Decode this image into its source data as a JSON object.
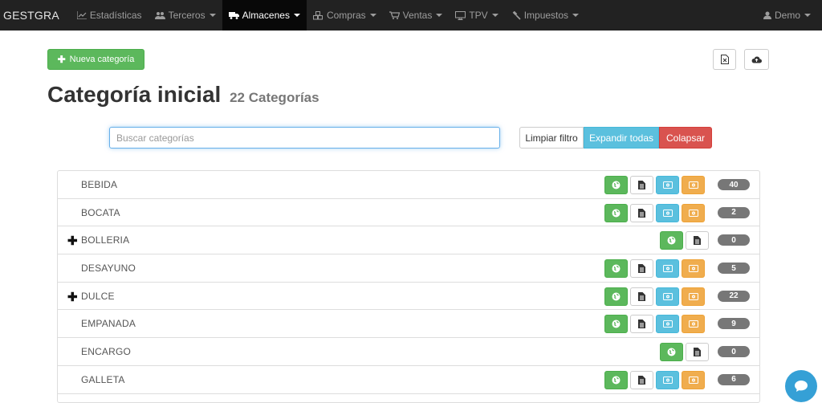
{
  "navbar": {
    "brand": "GESTGRA",
    "items": [
      {
        "label": "Estadísticas",
        "icon": "line-chart-icon",
        "dropdown": false,
        "active": false
      },
      {
        "label": "Terceros",
        "icon": "users-icon",
        "dropdown": true,
        "active": false
      },
      {
        "label": "Almacenes",
        "icon": "truck-icon",
        "dropdown": true,
        "active": true
      },
      {
        "label": "Compras",
        "icon": "cubes-icon",
        "dropdown": true,
        "active": false
      },
      {
        "label": "Ventas",
        "icon": "cart-icon",
        "dropdown": true,
        "active": false
      },
      {
        "label": "TPV",
        "icon": "desktop-icon",
        "dropdown": true,
        "active": false
      },
      {
        "label": "Impuestos",
        "icon": "gavel-icon",
        "dropdown": true,
        "active": false
      }
    ],
    "user": {
      "label": "Demo",
      "icon": "user-icon"
    }
  },
  "toolbar": {
    "new_label": "Nueva categoría",
    "export_icon": "excel-file-icon",
    "upload_icon": "cloud-upload-icon"
  },
  "header": {
    "title": "Categoría inicial",
    "count_text": "22 Categorías"
  },
  "search": {
    "placeholder": "Buscar categorías",
    "value": ""
  },
  "filters": {
    "clear_label": "Limpiar filtro",
    "expand_label": "Expandir todas",
    "collapse_label": "Colapsar"
  },
  "categories": [
    {
      "name": "BEBIDA",
      "expandable": false,
      "full_actions": true,
      "count": "40"
    },
    {
      "name": "BOCATA",
      "expandable": false,
      "full_actions": true,
      "count": "2"
    },
    {
      "name": "BOLLERIA",
      "expandable": true,
      "full_actions": false,
      "count": "0"
    },
    {
      "name": "DESAYUNO",
      "expandable": false,
      "full_actions": true,
      "count": "5"
    },
    {
      "name": "DULCE",
      "expandable": true,
      "full_actions": true,
      "count": "22"
    },
    {
      "name": "EMPANADA",
      "expandable": false,
      "full_actions": true,
      "count": "9"
    },
    {
      "name": "ENCARGO",
      "expandable": false,
      "full_actions": false,
      "count": "0"
    },
    {
      "name": "GALLETA",
      "expandable": false,
      "full_actions": true,
      "count": "6"
    }
  ],
  "colors": {
    "navbar": "#222222",
    "success": "#5cb85c",
    "info": "#5bc0de",
    "warning": "#f0ad4e",
    "danger": "#d9534f",
    "badge": "#777777",
    "chat": "#35a0d6"
  }
}
